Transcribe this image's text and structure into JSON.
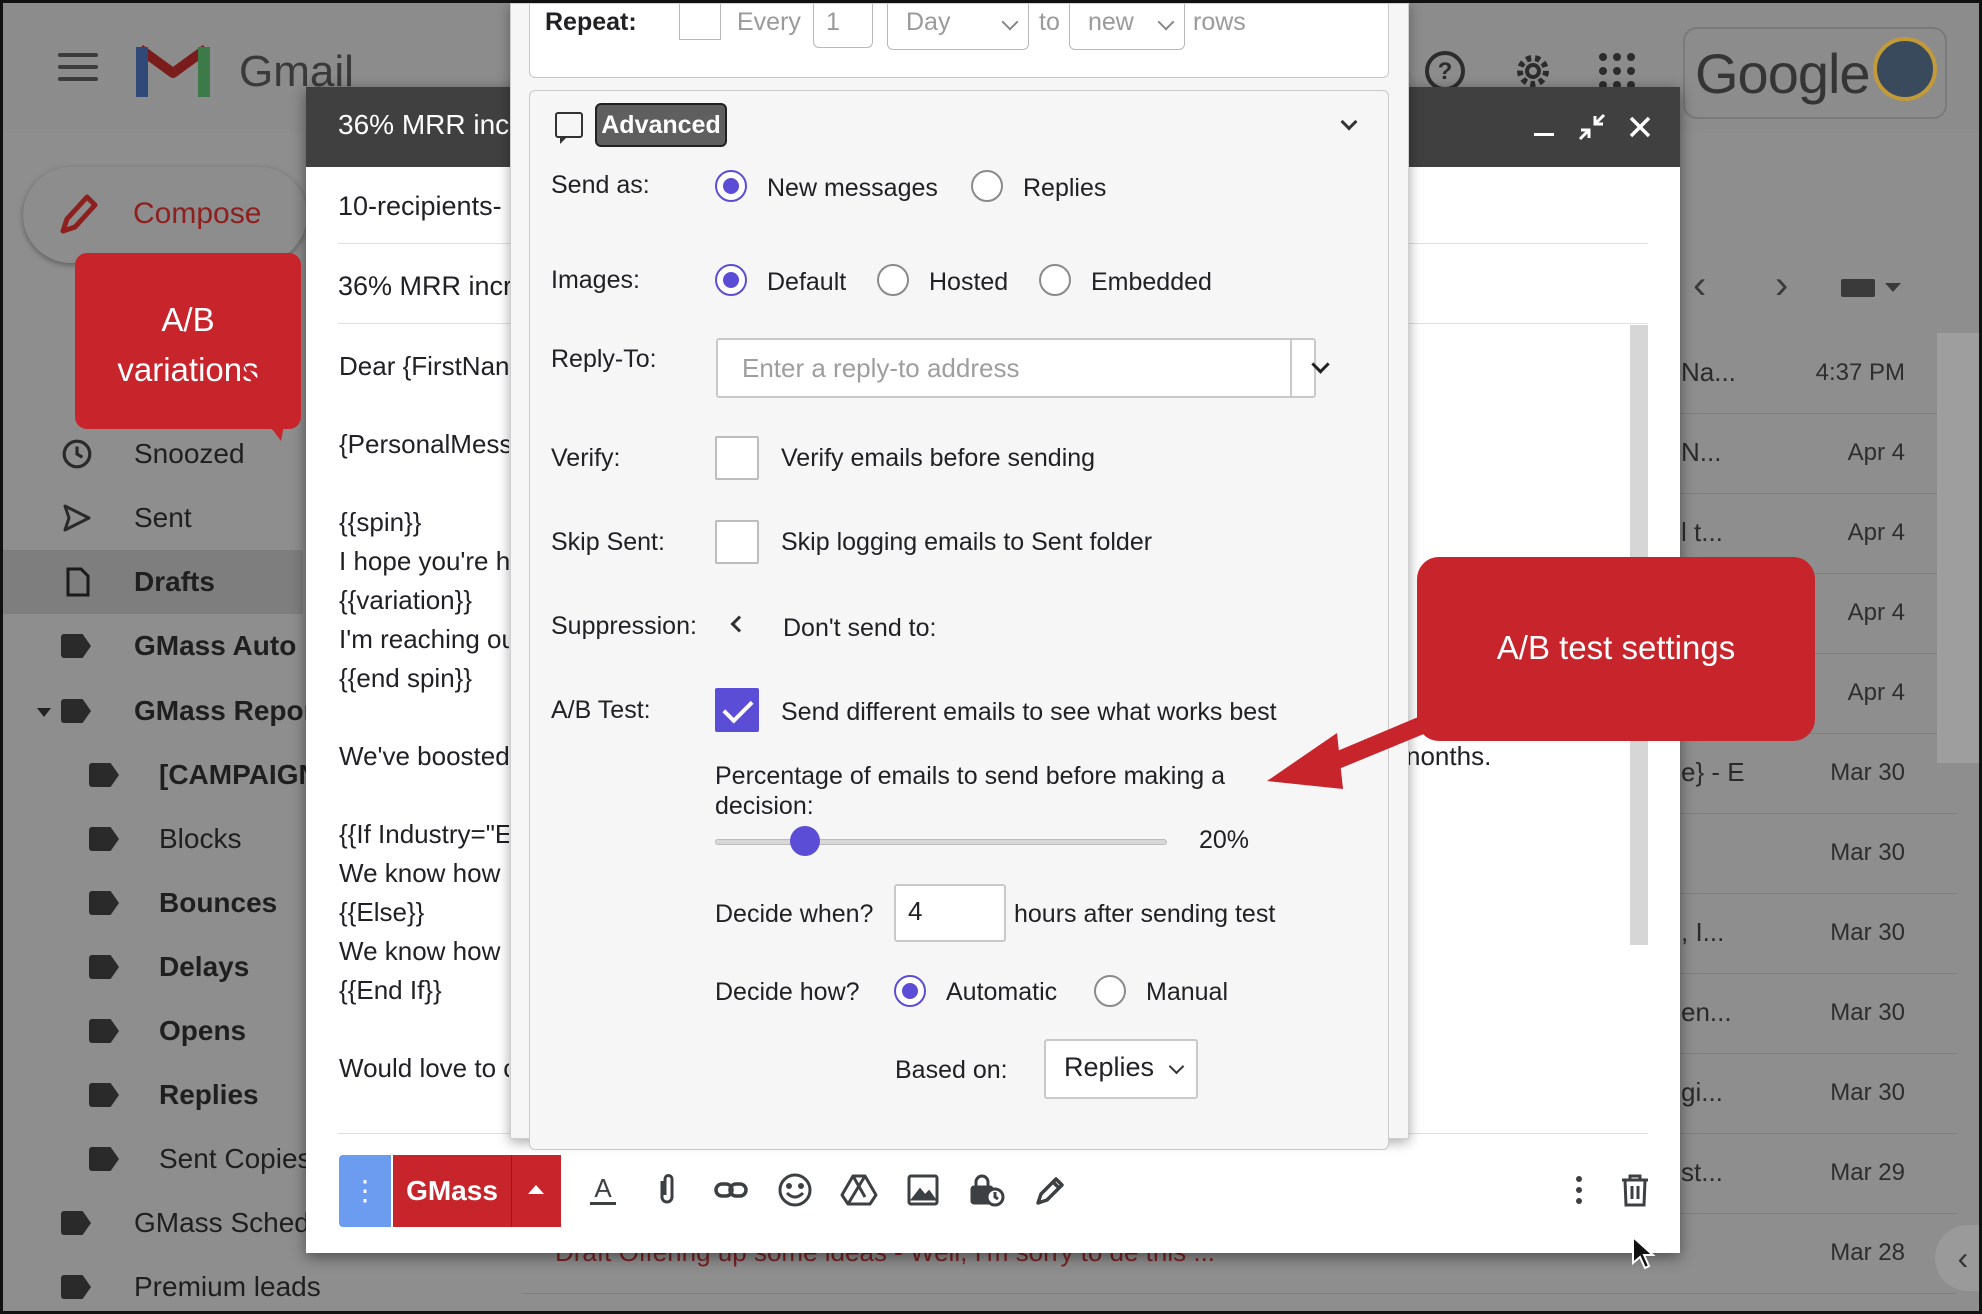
{
  "gmail": {
    "wordmark": "Gmail",
    "google_wordmark": "Google",
    "compose_label": "Compose",
    "sidebar": [
      {
        "label": "Snoozed",
        "icon": "clock-icon"
      },
      {
        "label": "Sent",
        "icon": "send-icon"
      },
      {
        "label": "Drafts",
        "icon": "draft-icon"
      },
      {
        "label": "GMass Auto F",
        "icon": "label-icon"
      },
      {
        "label": "GMass Repor",
        "icon": "label-icon"
      },
      {
        "label": "[CAMPAIGN",
        "icon": "label-icon"
      },
      {
        "label": "Blocks",
        "icon": "label-icon"
      },
      {
        "label": "Bounces",
        "icon": "label-icon"
      },
      {
        "label": "Delays",
        "icon": "label-icon"
      },
      {
        "label": "Opens",
        "icon": "label-icon"
      },
      {
        "label": "Replies",
        "icon": "label-icon"
      },
      {
        "label": "Sent Copies",
        "icon": "label-icon"
      },
      {
        "label": "GMass Sched",
        "icon": "label-icon"
      },
      {
        "label": "Premium leads",
        "icon": "label-icon"
      }
    ],
    "list_rows": [
      {
        "snippet": "Na...",
        "date": "4:37 PM"
      },
      {
        "snippet": "N...",
        "date": "Apr 4"
      },
      {
        "snippet": "l t...",
        "date": "Apr 4"
      },
      {
        "snippet": "",
        "date": "Apr 4"
      },
      {
        "snippet": "",
        "date": "Apr 4"
      },
      {
        "snippet": "e} - E",
        "date": "Mar 30"
      },
      {
        "snippet": "",
        "date": "Mar 30"
      },
      {
        "snippet": ", I...",
        "date": "Mar 30"
      },
      {
        "snippet": "en...",
        "date": "Mar 30"
      },
      {
        "snippet": "gi...",
        "date": "Mar 30"
      },
      {
        "snippet": "st...",
        "date": "Mar 29"
      },
      {
        "snippet": "Draft   Offering up some ideas - Well, I'm sorry to de this ...",
        "date": "Mar 28"
      }
    ]
  },
  "compose": {
    "title": "36% MRR inc",
    "to": "10-recipients-",
    "subject": "36% MRR incr",
    "body": [
      "Dear {FirstNan",
      "{PersonalMess",
      "{{spin}}",
      "I hope you're h",
      "{{variation}}",
      "I'm reaching ou",
      "{{end spin}}",
      "We've boosted",
      "{{If Industry=\"E",
      "We know how",
      "{{Else}}",
      "We know how",
      "{{End If}}",
      "Would love to c"
    ],
    "body_right": "nonths.",
    "send_more": "⋮",
    "send_label": "GMass"
  },
  "panel": {
    "repeat": {
      "label": "Repeat:",
      "every": "Every",
      "every_value": "1",
      "unit": "Day",
      "to": "to",
      "target": "new",
      "rows": "rows"
    },
    "advanced_label": "Advanced",
    "send_as": {
      "label": "Send as:",
      "options": [
        "New messages",
        "Replies"
      ],
      "selected": "New messages"
    },
    "images": {
      "label": "Images:",
      "options": [
        "Default",
        "Hosted",
        "Embedded"
      ],
      "selected": "Default"
    },
    "reply_to": {
      "label": "Reply-To:",
      "value": "",
      "placeholder": "Enter a reply-to address"
    },
    "verify": {
      "label": "Verify:",
      "text": "Verify emails before sending",
      "checked": false
    },
    "skip_sent": {
      "label": "Skip Sent:",
      "text": "Skip logging emails to Sent folder",
      "checked": false
    },
    "suppression": {
      "label": "Suppression:",
      "text": "Don't send to:"
    },
    "ab_test": {
      "label": "A/B Test:",
      "text": "Send different emails to see what works best",
      "checked": true,
      "percentage_label_1": "Percentage of emails to send before making a",
      "percentage_label_2": "decision:",
      "percentage_value": 20,
      "percentage_text": "20%",
      "decide_when_label": "Decide when?",
      "decide_when_value": "4",
      "decide_when_suffix": "hours after sending test",
      "decide_how_label": "Decide how?",
      "decide_how_options": [
        "Automatic",
        "Manual"
      ],
      "decide_how_selected": "Automatic",
      "based_on_label": "Based on:",
      "based_on_value": "Replies"
    }
  },
  "annotations": {
    "ab_variations": "A/B variations",
    "ab_settings": "A/B test settings"
  },
  "colors": {
    "accent_purple": "#5b4dd6",
    "gmass_red": "#c8242b",
    "callout_red": "#c8242b",
    "compose_header": "#404040",
    "more_blue": "#6b9cf0"
  }
}
